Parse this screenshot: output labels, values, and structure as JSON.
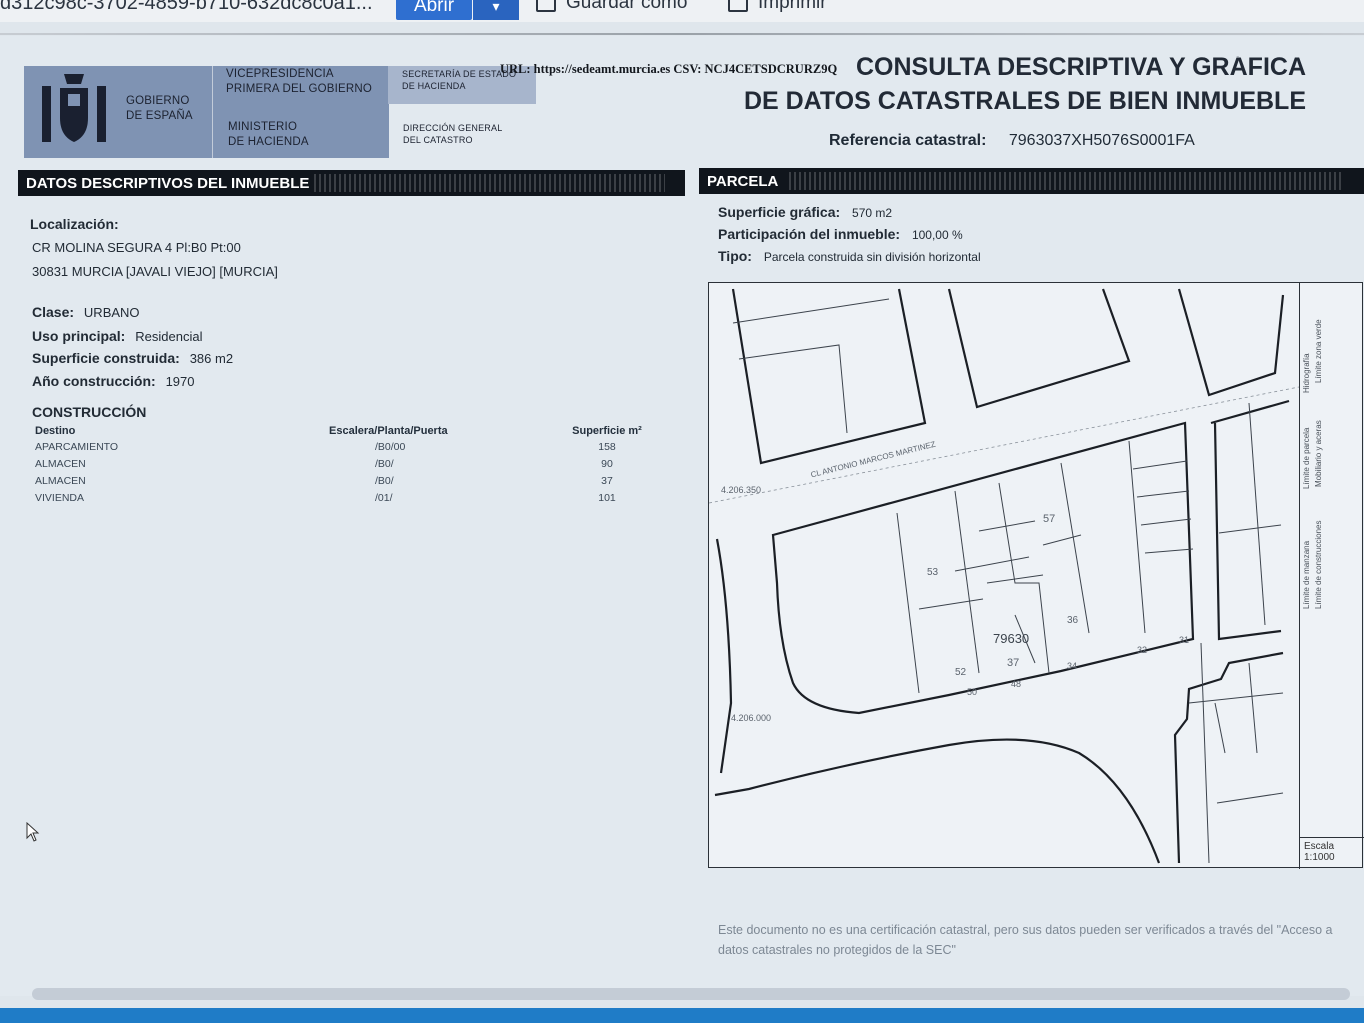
{
  "toolbar": {
    "filename": "d312c98c-3702-4859-b710-632dc8c0a1...",
    "open_label": "Abrir",
    "open_menu_icon": "chevron-down-icon",
    "save_as_label": "Guardar como",
    "print_label": "Imprimir"
  },
  "header": {
    "gov_name": "GOBIERNO\nDE ESPAÑA",
    "vice": "VICEPRESIDENCIA\nPRIMERA DEL GOBIERNO",
    "ministry": "MINISTERIO\nDE HACIENDA",
    "secretary": "SECRETARÍA DE ESTADO\nDE HACIENDA",
    "direction": "DIRECCIÓN GENERAL\nDEL CATASTRO",
    "url_line": "URL: https://sedeamt.murcia.es CSV: NCJ4CETSDCRURZ9Q",
    "title_line1": "CONSULTA DESCRIPTIVA Y GRÁFICA",
    "title_line2": "DE DATOS CATASTRALES DE BIEN INMUEBLE",
    "refcat_label": "Referencia catastral:",
    "refcat_value": "7963037XH5076S0001FA"
  },
  "left_section": {
    "title": "DATOS DESCRIPTIVOS DEL INMUEBLE",
    "localizacion_label": "Localización:",
    "address_line1": "CR MOLINA SEGURA 4 Pl:B0 Pt:00",
    "address_line2": "30831 MURCIA [JAVALI VIEJO] [MURCIA]",
    "clase_label": "Clase:",
    "clase_value": "URBANO",
    "uso_label": "Uso principal:",
    "uso_value": "Residencial",
    "superficie_label": "Superficie construida:",
    "superficie_value": "386 m2",
    "anio_label": "Año construcción:",
    "anio_value": "1970",
    "construccion_title": "CONSTRUCCIÓN",
    "table": {
      "headers": [
        "Destino",
        "Escalera/Planta/Puerta",
        "Superficie m²"
      ],
      "rows": [
        [
          "APARCAMIENTO",
          "/B0/00",
          "158"
        ],
        [
          "ALMACEN",
          "/B0/",
          "90"
        ],
        [
          "ALMACEN",
          "/B0/",
          "37"
        ],
        [
          "VIVIENDA",
          "/01/",
          "101"
        ]
      ]
    }
  },
  "right_section": {
    "title": "PARCELA",
    "sup_grafica_label": "Superficie gráfica:",
    "sup_grafica_value": "570 m2",
    "participacion_label": "Participación del inmueble:",
    "participacion_value": "100,00 %",
    "tipo_label": "Tipo:",
    "tipo_value": "Parcela construida sin división horizontal"
  },
  "map": {
    "parcel_label": "79630",
    "parcel_sub": "37",
    "street_label": "CL ANTONIO MARCOS MARTINEZ",
    "coord_top": "4.206.350",
    "coord_bottom": "4.206.000",
    "numbers": [
      "57",
      "53",
      "36",
      "52",
      "50",
      "48",
      "34",
      "32",
      "31"
    ],
    "scale_label": "Escala",
    "scale_value": "1:1000",
    "legend_items": [
      "Límite zona verde",
      "Hidrografía",
      "Mobiliario y aceras",
      "Límite de parcela",
      "Límite de construcciones",
      "Límite de manzana"
    ]
  },
  "footer": {
    "note": "Este documento no es una certificación catastral, pero sus datos pueden ser verificados a través del \"Acceso a datos catastrales no protegidos de la SEC\""
  }
}
